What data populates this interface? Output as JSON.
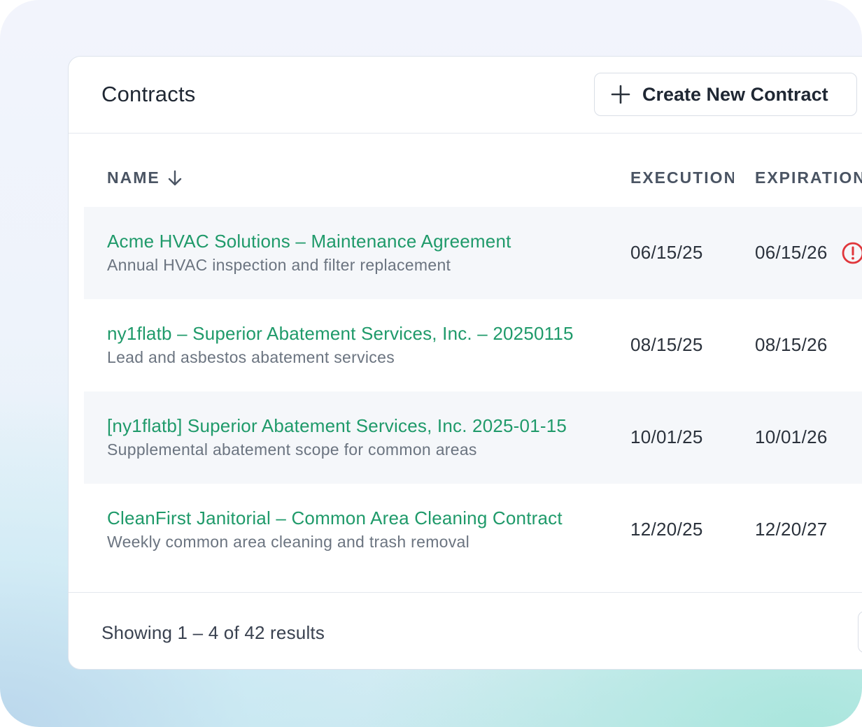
{
  "header": {
    "title": "Contracts",
    "create_button_label": "Create New Contract"
  },
  "table": {
    "columns": {
      "name": "NAME",
      "execution": "EXECUTION",
      "expiration": "EXPIRATION"
    },
    "sort": "descending",
    "rows": [
      {
        "name": "Acme HVAC Solutions – Maintenance Agreement",
        "description": "Annual HVAC inspection and filter replacement",
        "execution": "06/15/25",
        "expiration": "06/15/26",
        "alert_icon": "alert-circle-icon"
      },
      {
        "name": "ny1flatb – Superior Abatement Services, Inc. – 20250115",
        "description": "Lead and asbestos abatement services",
        "execution": "08/15/25",
        "expiration": "08/15/26"
      },
      {
        "name": "[ny1flatb] Superior Abatement Services, Inc. 2025-01-15",
        "description": "Supplemental abatement scope for common areas",
        "execution": "10/01/25",
        "expiration": "10/01/26"
      },
      {
        "name": "CleanFirst Janitorial – Common Area Cleaning Contract",
        "description": "Weekly common area cleaning and trash removal",
        "execution": "12/20/25",
        "expiration": "12/20/27"
      }
    ]
  },
  "footer": {
    "results_text": "Showing 1 – 4 of 42 results"
  },
  "colors": {
    "link_green": "#1f9a6a",
    "alert_red": "#e0363b",
    "row_shade": "#f5f7fa"
  }
}
